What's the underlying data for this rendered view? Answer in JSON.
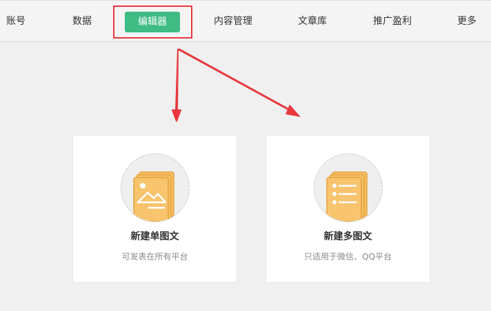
{
  "nav": {
    "items": [
      "账号",
      "数据",
      "编辑器",
      "内容管理",
      "文章库",
      "推广盈利",
      "更多"
    ],
    "active_index": 2,
    "active_color": "#3fbb84",
    "highlight_color": "#e8383d"
  },
  "cards": [
    {
      "title": "新建单图文",
      "subtitle": "可发表在所有平台",
      "icon": "image-document-icon"
    },
    {
      "title": "新建多图文",
      "subtitle": "只适用于微信、QQ平台",
      "icon": "list-document-icon"
    }
  ],
  "colors": {
    "icon_fill": "#f7c066",
    "icon_stroke": "#e3a23a",
    "arrow": "#e8383d"
  }
}
